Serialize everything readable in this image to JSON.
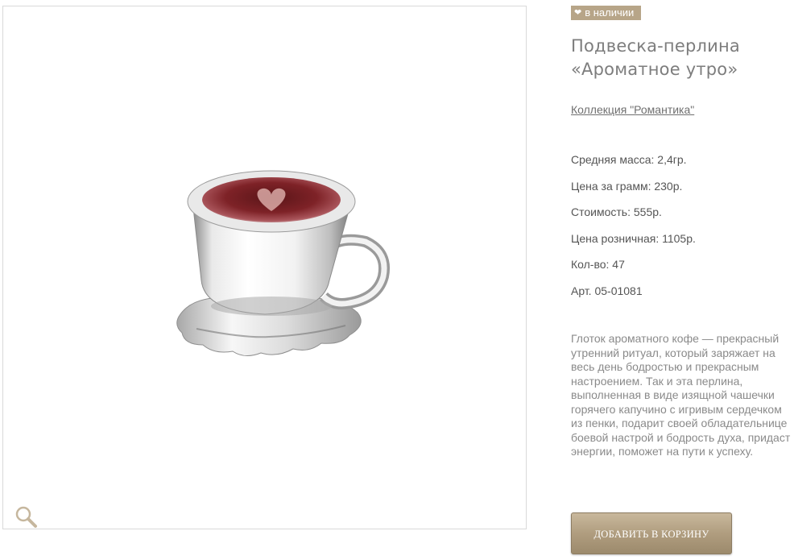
{
  "product": {
    "availability_badge": "в наличии",
    "title_line1": "Подвеска-перлина",
    "title_line2": "«Ароматное утро»",
    "collection_link": "Коллекция \"Романтика\"",
    "specs": {
      "average_weight": "Средняя масса: 2,4гр.",
      "price_per_gram": "Цена за грамм: 230р.",
      "cost": "Стоимость: 555р.",
      "retail_price": "Цена розничная: 1105р.",
      "quantity": "Кол-во: 47",
      "article": "Арт. 05-01081"
    },
    "description": "Глоток ароматного кофе — прекрасный утренний ритуал, который заряжает на весь день бодростью и прекрасным настроением. Так и эта перлина, выполненная в виде изящной чашечки горячего капучино с игривым сердечком из пенки, подарит своей обладательнице боевой настрой и бодрость духа, придаст энергии, поможет на пути к успеху.",
    "add_to_cart_label": "ДОБАВИТЬ В КОРЗИНУ"
  },
  "icons": {
    "badge_icon": "heart-icon",
    "zoom_icon": "magnifier-icon"
  },
  "colors": {
    "badge_bg": "#b7a588",
    "button_bg": "#b09d7f",
    "enamel": "#7a1e22"
  }
}
